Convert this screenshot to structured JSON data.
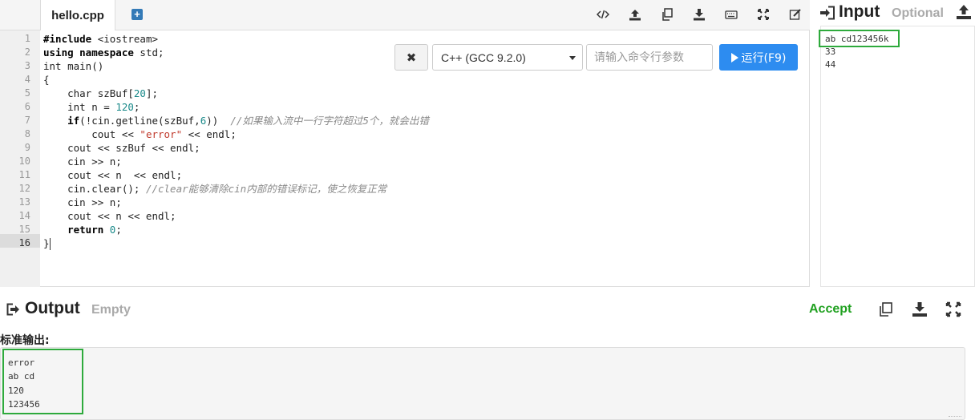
{
  "editor": {
    "tab_label": "hello.cpp",
    "new_tab_glyph": "+",
    "toolbar_icons": [
      "code-icon",
      "upload-icon",
      "copy-icon",
      "download-icon",
      "keyboard-icon",
      "fullscreen-icon",
      "edit-icon"
    ],
    "line_numbers": [
      "1",
      "2",
      "3",
      "4",
      "5",
      "6",
      "7",
      "8",
      "9",
      "10",
      "11",
      "12",
      "13",
      "14",
      "15",
      "16"
    ],
    "active_line": "16"
  },
  "run_controls": {
    "clear_glyph": "✖",
    "language": "C++ (GCC 9.2.0)",
    "args_placeholder": "请输入命令行参数",
    "run_label": "运行(F9)"
  },
  "input_panel": {
    "title": "Input",
    "status": "Optional",
    "lines": [
      "ab cd123456k",
      "33",
      "44"
    ]
  },
  "output_panel": {
    "title": "Output",
    "status": "Empty",
    "accept_label": "Accept",
    "stdout_label": "标准输出:",
    "lines": [
      "error",
      "ab cd",
      "120",
      "123456"
    ]
  },
  "colors": {
    "run_button": "#2d8cf0",
    "accept": "#21a121",
    "highlight_box": "#2eaa3c",
    "number_literal": "#1a8a8a",
    "string_literal": "#c0392b",
    "comment": "#8a8a8a"
  }
}
